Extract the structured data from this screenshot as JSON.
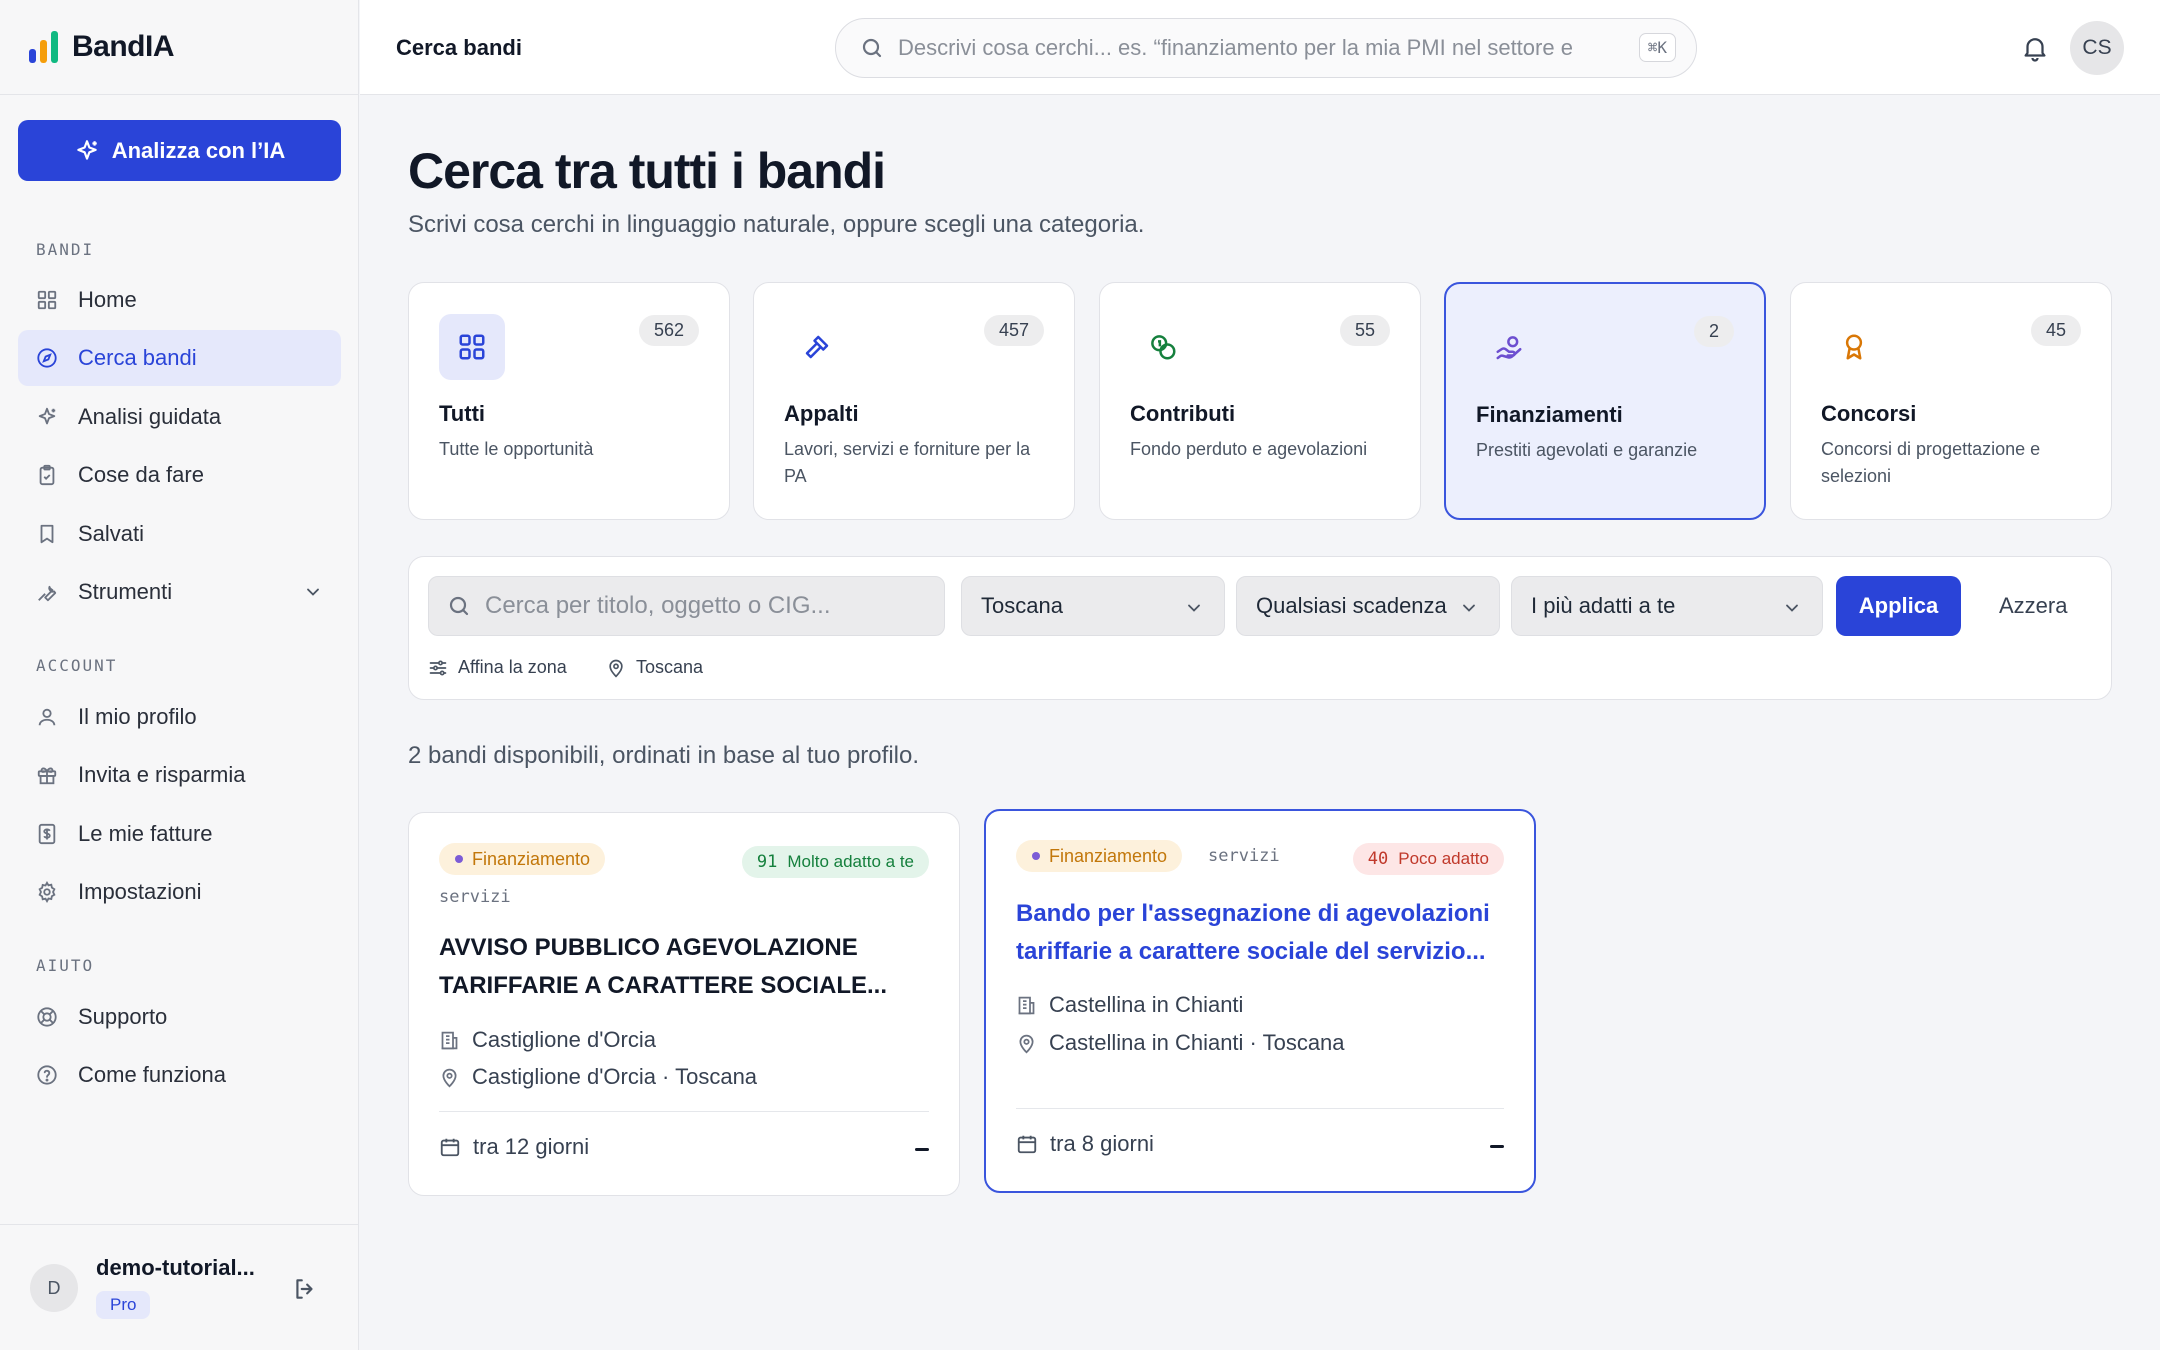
{
  "brand": {
    "name": "BandIA",
    "logo_colors": [
      "#2a44d8",
      "#f59e0b",
      "#10b981"
    ]
  },
  "sidebar": {
    "ai_button_label": "Analizza con l’IA",
    "sections": {
      "bandi": "BANDI",
      "account": "ACCOUNT",
      "aiuto": "AIUTO"
    },
    "items": [
      {
        "label": "Home",
        "icon": "grid-icon"
      },
      {
        "label": "Cerca bandi",
        "icon": "compass-icon",
        "active": true
      },
      {
        "label": "Analisi guidata",
        "icon": "sparkle-icon"
      },
      {
        "label": "Cose da fare",
        "icon": "clipboard-icon"
      },
      {
        "label": "Salvati",
        "icon": "bookmark-icon"
      },
      {
        "label": "Strumenti",
        "icon": "wrench-icon",
        "expandable": true
      },
      {
        "label": "Il mio profilo",
        "icon": "user-icon"
      },
      {
        "label": "Invita e risparmia",
        "icon": "gift-icon"
      },
      {
        "label": "Le mie fatture",
        "icon": "invoice-icon"
      },
      {
        "label": "Impostazioni",
        "icon": "gear-icon"
      },
      {
        "label": "Supporto",
        "icon": "lifebuoy-icon"
      },
      {
        "label": "Come funziona",
        "icon": "help-circle-icon"
      }
    ],
    "user": {
      "initial": "D",
      "name": "demo-tutorial...",
      "plan": "Pro"
    }
  },
  "header": {
    "title": "Cerca bandi",
    "search_placeholder": "Descrivi cosa cerchi... es. “finanziamento per la mia PMI nel settore e",
    "shortcut": "⌘K",
    "avatar_initials": "CS"
  },
  "main": {
    "title": "Cerca tra tutti i bandi",
    "subtitle": "Scrivi cosa cerchi in linguaggio naturale, oppure scegli una categoria.",
    "categories": [
      {
        "name": "Tutti",
        "desc": "Tutte le opportunità",
        "count": "562",
        "icon": "grid-icon",
        "color": "#2a44d8"
      },
      {
        "name": "Appalti",
        "desc": "Lavori, servizi e forniture per la PA",
        "count": "457",
        "icon": "gavel-icon",
        "color": "#2a44d8"
      },
      {
        "name": "Contributi",
        "desc": "Fondo perduto e agevolazioni",
        "count": "55",
        "icon": "coins-icon",
        "color": "#15803d"
      },
      {
        "name": "Finanziamenti",
        "desc": "Prestiti agevolati e garanzie",
        "count": "2",
        "icon": "hand-coin-icon",
        "color": "#6d4fd0",
        "selected": true
      },
      {
        "name": "Concorsi",
        "desc": "Concorsi di progettazione e selezioni",
        "count": "45",
        "icon": "award-icon",
        "color": "#d97706"
      }
    ],
    "filters": {
      "search_placeholder": "Cerca per titolo, oggetto o CIG...",
      "region": "Toscana",
      "deadline": "Qualsiasi scadenza",
      "sort": "I più adatti a te",
      "apply_label": "Applica",
      "reset_label": "Azzera",
      "refine_label": "Affina la zona",
      "location_tag": "Toscana"
    },
    "result_count": "2 bandi disponibili, ordinati in base al tuo profilo.",
    "results": [
      {
        "type": "Finanziamento",
        "sector": "servizi",
        "score": "91",
        "score_label": "Molto adatto a te",
        "title": "AVVISO PUBBLICO AGEVOLAZIONE TARIFFARIE A CARATTERE SOCIALE...",
        "entity": "Castiglione d'Orcia",
        "location": "Castiglione d'Orcia · Toscana",
        "deadline": "tra 12 giorni"
      },
      {
        "type": "Finanziamento",
        "sector": "servizi",
        "score": "40",
        "score_label": "Poco adatto",
        "title": "Bando per l'assegnazione di agevolazioni tariffarie a carattere sociale del servizio...",
        "entity": "Castellina in Chianti",
        "location": "Castellina in Chianti · Toscana",
        "deadline": "tra 8 giorni"
      }
    ]
  }
}
